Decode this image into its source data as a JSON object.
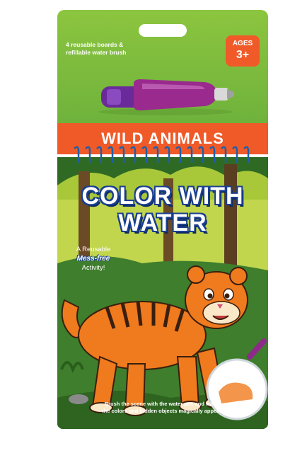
{
  "package": {
    "contents_note": "4 reusable boards &\nrefillable water brush",
    "ages_label": "AGES",
    "ages_value": "3+",
    "banner_title": "WILD ANIMALS",
    "book_title_line1": "COLOR WITH",
    "book_title_line2": "WATER",
    "tagline_line1": "A Reusable",
    "tagline_line2": "Mess-free",
    "tagline_line3": "Activity!",
    "instructions": "Brush the scene with the water pen and watch\nthe colors and hidden objects magically appear!"
  },
  "colors": {
    "header_green": "#8cc53f",
    "orange": "#f05a28",
    "forest_green": "#3e7e2c",
    "title_blue": "#1a3f8f",
    "pen_purple": "#8e2a8a"
  },
  "icons": [
    "water-pen-icon",
    "tiger-illustration",
    "preview-circle-icon"
  ]
}
